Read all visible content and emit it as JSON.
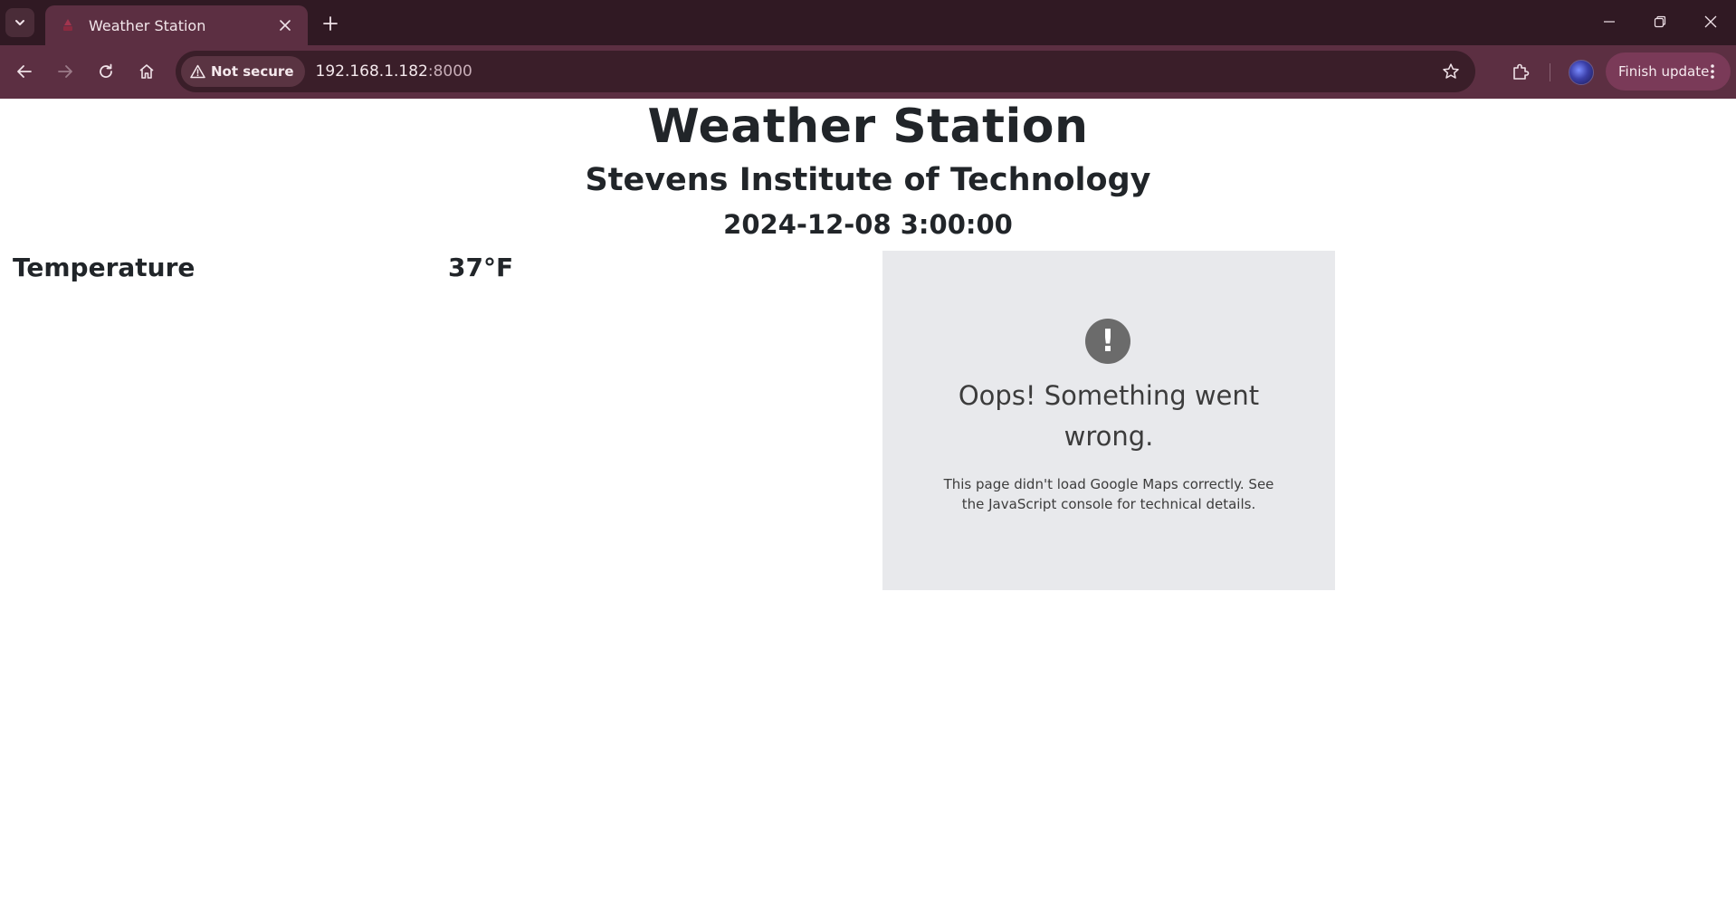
{
  "browser": {
    "tab": {
      "title": "Weather Station"
    },
    "omnibox": {
      "security_label": "Not secure",
      "url_host": "192.168.1.182",
      "url_port": ":8000"
    },
    "finish_update_label": "Finish update",
    "colors": {
      "tabstrip": "#301923",
      "toolbar": "#5c2f42",
      "omnibox": "#3a1e29"
    },
    "icons": [
      "tab-search-icon",
      "weather-favicon-icon",
      "close-icon",
      "plus-icon",
      "minimize-icon",
      "restore-icon",
      "close-window-icon",
      "back-arrow-icon",
      "forward-arrow-icon",
      "reload-icon",
      "home-icon",
      "warning-triangle-icon",
      "star-icon",
      "extensions-puzzle-icon",
      "more-vert-icon"
    ]
  },
  "page": {
    "title": "Weather Station",
    "subtitle": "Stevens Institute of Technology",
    "timestamp": "2024-12-08 3:00:00",
    "reading": {
      "label": "Temperature",
      "value": "37°F"
    },
    "map_error": {
      "icon": "!",
      "title": "Oops! Something went wrong.",
      "message": "This page didn't load Google Maps correctly. See the JavaScript console for technical details."
    }
  }
}
